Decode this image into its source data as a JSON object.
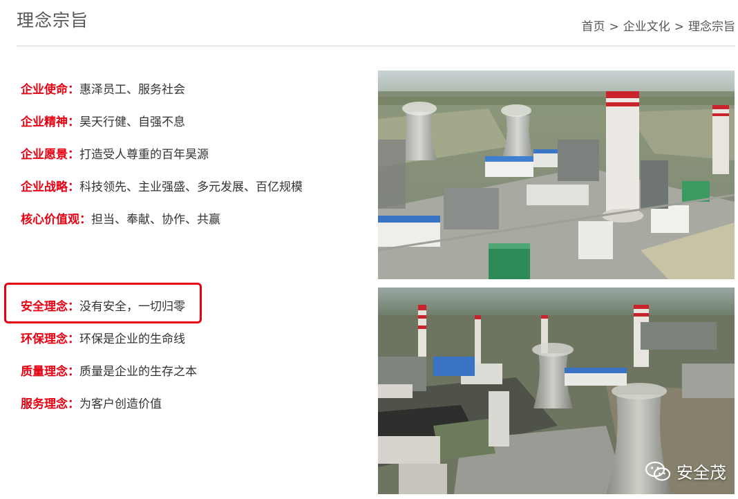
{
  "header": {
    "title": "理念宗旨",
    "breadcrumb": [
      "首页",
      "企业文化",
      "理念宗旨"
    ],
    "separator": ">"
  },
  "values": [
    {
      "label": "企业使命：",
      "text": "惠泽员工、服务社会"
    },
    {
      "label": "企业精神：",
      "text": "昊天行健、自强不息"
    },
    {
      "label": "企业愿景：",
      "text": "打造受人尊重的百年昊源"
    },
    {
      "label": "企业战略：",
      "text": "科技领先、主业强盛、多元发展、百亿规模"
    },
    {
      "label": "核心价值观：",
      "text": "担当、奉献、协作、共赢"
    }
  ],
  "concepts": [
    {
      "label": "安全理念：",
      "text": "没有安全，一切归零",
      "highlighted": true
    },
    {
      "label": "环保理念：",
      "text": "环保是企业的生命线"
    },
    {
      "label": "质量理念：",
      "text": "质量是企业的生存之本"
    },
    {
      "label": "服务理念：",
      "text": "为客户创造价值"
    }
  ],
  "images": [
    {
      "name": "plant-photo-1",
      "description_icon": "factory-aerial-image"
    },
    {
      "name": "plant-photo-2",
      "description_icon": "factory-aerial-image"
    }
  ],
  "watermark": {
    "text": "安全茂",
    "icon": "wechat-icon"
  },
  "colors": {
    "accent": "#e60012",
    "text": "#333333",
    "title": "#555555"
  }
}
